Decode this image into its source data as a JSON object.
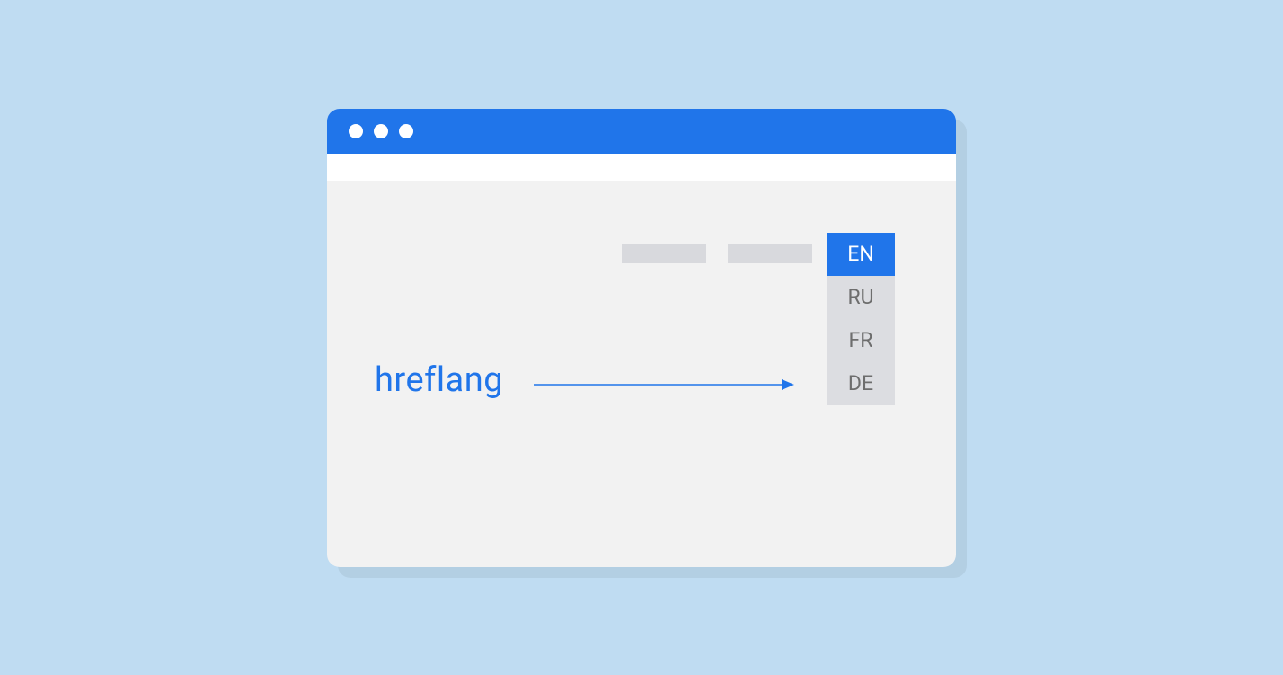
{
  "colors": {
    "background": "#bfdcf2",
    "accent": "#2075ea",
    "window_bg": "#f2f2f2",
    "placeholder": "#d8d9dd",
    "dropdown_bg": "#dcdde1",
    "dropdown_text": "#6d6d6d"
  },
  "label": "hreflang",
  "languages": [
    {
      "code": "EN",
      "selected": true
    },
    {
      "code": "RU",
      "selected": false
    },
    {
      "code": "FR",
      "selected": false
    },
    {
      "code": "DE",
      "selected": false
    }
  ]
}
